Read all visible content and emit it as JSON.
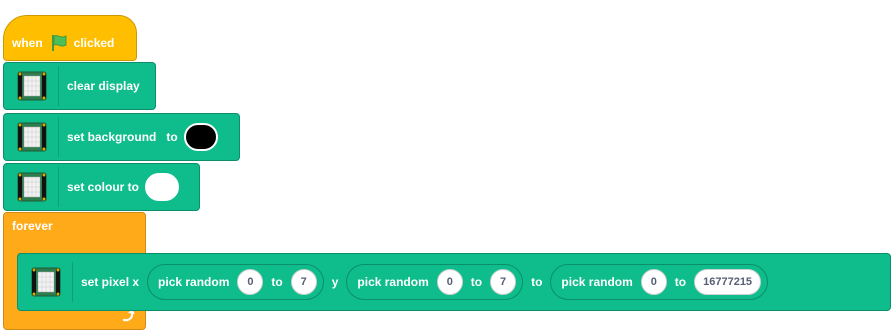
{
  "hat": {
    "when": "when",
    "clicked": "clicked"
  },
  "blocks": {
    "clear": "clear display",
    "background_label": "set background",
    "background_to": "to",
    "background_color": "#000000",
    "colour_label": "set colour to",
    "colour_color": "#ffffff"
  },
  "forever": {
    "label": "forever"
  },
  "set_pixel": {
    "label": "set pixel x",
    "y_label": "y",
    "to_label": "to",
    "x_random": {
      "label": "pick random",
      "from": "0",
      "to_label": "to",
      "to": "7"
    },
    "y_random": {
      "label": "pick random",
      "from": "0",
      "to_label": "to",
      "to": "7"
    },
    "color_random": {
      "label": "pick random",
      "from": "0",
      "to_label": "to",
      "to": "16777215"
    }
  },
  "colors": {
    "events": "#ffbf00",
    "control": "#ffab19",
    "extension": "#0fbd8c"
  },
  "icons": {
    "flag": "green-flag-icon",
    "board": "sense-hat-board-icon",
    "loop": "loop-arrow-icon"
  }
}
